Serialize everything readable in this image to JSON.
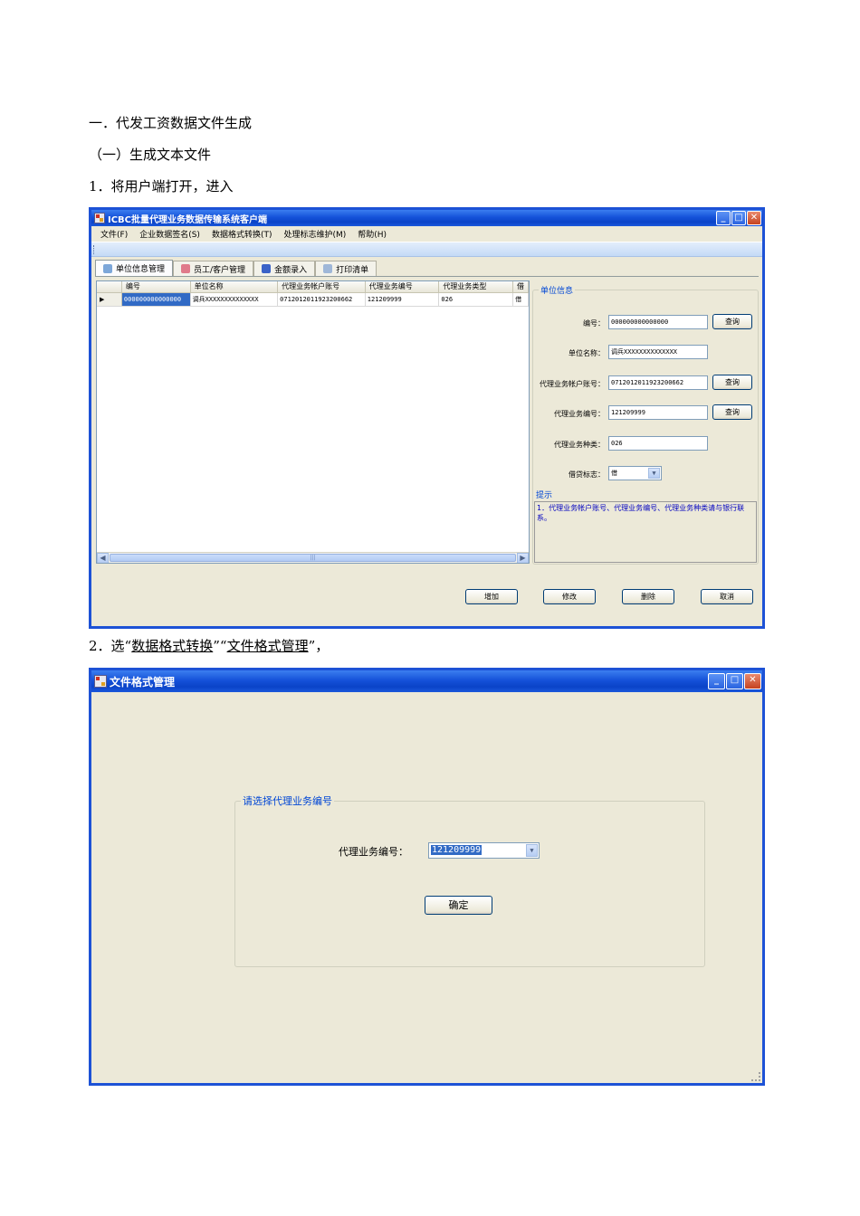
{
  "doc": {
    "heading": "一．代发工资数据文件生成",
    "subheading": "（一）生成文本文件",
    "step1": "1．将用户端打开，进入",
    "step2_prefix": "2．选“",
    "step2_menu1": "数据格式转换",
    "step2_mid": "”“",
    "step2_menu2": "文件格式管理",
    "step2_suffix": "”，"
  },
  "window1": {
    "title": "ICBC批量代理业务数据传输系统客户端",
    "menu": [
      "文件(F)",
      "企业数据签名(S)",
      "数据格式转换(T)",
      "处理标志维护(M)",
      "帮助(H)"
    ],
    "tabs": [
      "单位信息管理",
      "员工/客户管理",
      "金额录入",
      "打印清单"
    ],
    "grid": {
      "columns": [
        "编号",
        "单位名称",
        "代理业务帐户账号",
        "代理业务编号",
        "代理业务类型",
        "借"
      ],
      "row": [
        "000000000000000",
        "调兵XXXXXXXXXXXXXX",
        "0712012011923200662",
        "121209999",
        "026",
        "借"
      ],
      "row_indicator": "▶"
    },
    "unit_info": {
      "title": "单位信息",
      "labels": [
        "编号：",
        "单位名称：",
        "代理业务帐户账号：",
        "代理业务编号：",
        "代理业务种类：",
        "借贷标志："
      ],
      "values": [
        "000000000000000",
        "调兵XXXXXXXXXXXXXX",
        "0712012011923200662",
        "121209999",
        "026",
        "借"
      ],
      "query": "查询"
    },
    "hint": {
      "title": "提示",
      "text": "1．代理业务帐户账号、代理业务编号、代理业务种类请与银行联系。"
    },
    "buttons": [
      "增加",
      "修改",
      "删除",
      "取消"
    ]
  },
  "window2": {
    "title": "文件格式管理",
    "group_title": "请选择代理业务编号",
    "label": "代理业务编号：",
    "select_value": "121209999",
    "ok": "确定"
  },
  "colors": {
    "xp_title_blue": "#0a43c8",
    "window_face": "#ece9d8",
    "group_title_blue": "#0046d5",
    "selection_blue": "#316ac5"
  }
}
